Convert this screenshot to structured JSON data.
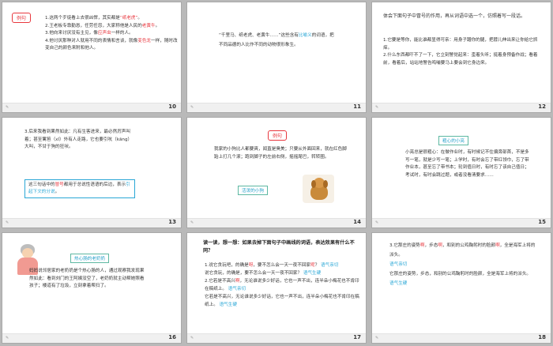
{
  "slides": [
    {
      "num": "10",
      "tag": "例句",
      "lines": [
        {
          "pre": "1.这两个歹徒看上去很凶悍，其实都是",
          "red": "“纸老虎”",
          "post": "。"
        },
        {
          "pre": "2.王老板专靠勤恳，任劳任怨，大家称他是人民的",
          "red": "老黄牛",
          "post": "。"
        },
        {
          "pre": "3.他向来讨厌没有主见，像",
          "red": "应声虫",
          "post": "一样的人。"
        },
        {
          "pre": "4.他讨厌那种对人就用不同的表情和言谈，就像",
          "red": "变色龙",
          "post": "一样，随时改变自己的颜色来附和他人。"
        }
      ]
    },
    {
      "num": "11",
      "text_pre": "“千里马、纸老虎、老黄牛……”这些含有",
      "blue": "比喻义",
      "text_post": "的词语，把不同品德的人比作不同的动物很形象生。"
    },
    {
      "num": "12",
      "heading": "体会下面句子中冒号的作用，再从词语中选一个，仿照着写一段话。",
      "lines": [
        "1.它要是等你，能比谁都显得可亲：用身子蹭你的腿，把脖儿伸出来让你给它抓痒。",
        "2.什么东西都吓不了一下，它立刻警觉起来：歪着头听；挺着身预备作战；看着前，看着后，站站地警告鸣哺要马上要会到它身边来。"
      ]
    },
    {
      "num": "13",
      "lines": [
        "3.后来我看到果然如此：凡有生客进来，最必然厉声叫着；甚至篱笆（xǐ）外有人走路，它也要引吭（kāng）大叫，不甘于狗的狂吠。"
      ],
      "box_pre": "这三句话中的",
      "box_blue": "冒号",
      "box_mid": "都用于总说性语语的后边，表示",
      "box_blue2": "引起下文的分说",
      "box_post": "。"
    },
    {
      "num": "14",
      "tag": "例句",
      "text": "我家的小狗比人都要爽，闻直是臭美；只要从外面回来，就在红色脚跆上打几个滚；跑到脚子的左前右侧，摇摇尾巴，转转圈。",
      "label": "活泼的小狗"
    },
    {
      "num": "15",
      "tag": "粗心的小亮",
      "text": "小亮总是很粗心：在做作业时，有时候记不住偏旁部首，不是多写一笔，就是少写一笔；上学时，有时会忘了带红领巾，忘了带作业本，甚至忘了带书本；轮到值日时，有时忘了该自己值日；考试时，有时会跳过题，或者没看清要求……"
    },
    {
      "num": "16",
      "tag": "热心肠的老奶奶",
      "text": "妈妈说邻居家的老奶奶是个热心肠的人，通过观察我发现果然如此：看到刘门的王阿姨没空了，老奶奶就主动帮她照看孩子；楼道有了垃圾，立刻拿着帮扫了。"
    },
    {
      "num": "17",
      "heading": "读一读，想一想：如果去掉下面句子中画线的词语，表达效果有什么不同？",
      "items": [
        {
          "pre": "1.说它贪玩吧，的确是",
          "red": "呀",
          "mid": "，要不怎么会一天一夜不回家",
          "red2": "呢",
          "post": "？",
          "tag": "语气亲切"
        },
        {
          "pre": "说它贪玩，的确是，要不怎么会一天一夜不回家？",
          "tag": "语气生硬"
        },
        {
          "pre": "2.它若是不高兴",
          "red": "啊",
          "mid": "，无论谁说多少好话，它也一声不出，连半朵小梅花也不肯印在稿纸上。",
          "tag": "语气亲切"
        },
        {
          "pre": "它若是不高兴，无论谁说多少好话，它也一声不出，连半朵小梅花也不肯印在稿纸上。",
          "tag": "语气生硬"
        }
      ]
    },
    {
      "num": "18",
      "line1_pre": "3.它那庄的姿势",
      "line1_red": "啊",
      "line1_mid": "，步态",
      "line1_red2": "啊",
      "line1_post": "，和别的公鸡鞠躬时的脸颜",
      "line1_red3": "啊",
      "line1_post2": "，全是海军上将的派头。",
      "tag1": "语气亲切",
      "line2": "它那庄的姿势，步态，和别的公鸡鞠躬时的脸颜，全是海军上将的派头。",
      "tag2": "语气生硬"
    }
  ]
}
